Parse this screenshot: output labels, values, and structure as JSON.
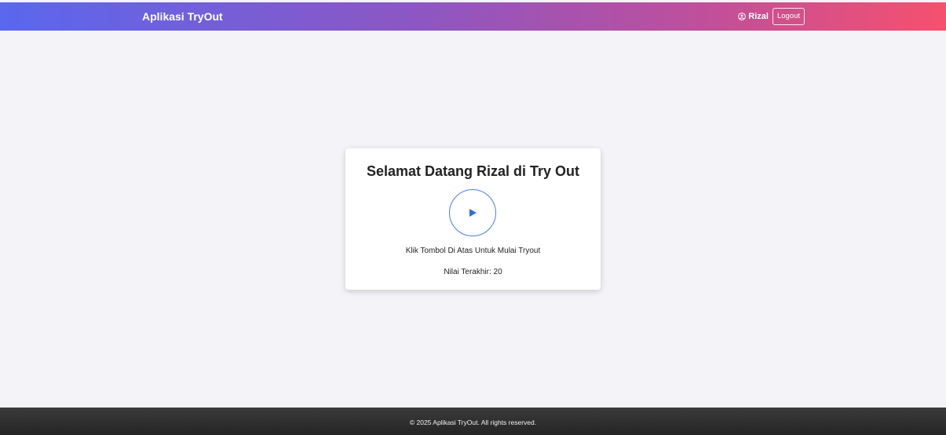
{
  "header": {
    "brand": "Aplikasi TryOut",
    "user_icon": "user-circle-icon",
    "user_name": "Rizal",
    "logout_label": "Logout",
    "gradient_colors": [
      "#5a67ee",
      "#8e56c2",
      "#c14f9a",
      "#f6506e"
    ]
  },
  "main": {
    "title": "Selamat Datang Rizal di Try Out",
    "play_icon": "play-icon",
    "accent_color": "#2f6fe0",
    "hint": "Klik Tombol Di Atas Untuk Mulai Tryout",
    "last_score": "Nilai Terakhir: 20"
  },
  "footer": {
    "copyright": "© 2025 Aplikasi TryOut. All rights reserved."
  }
}
